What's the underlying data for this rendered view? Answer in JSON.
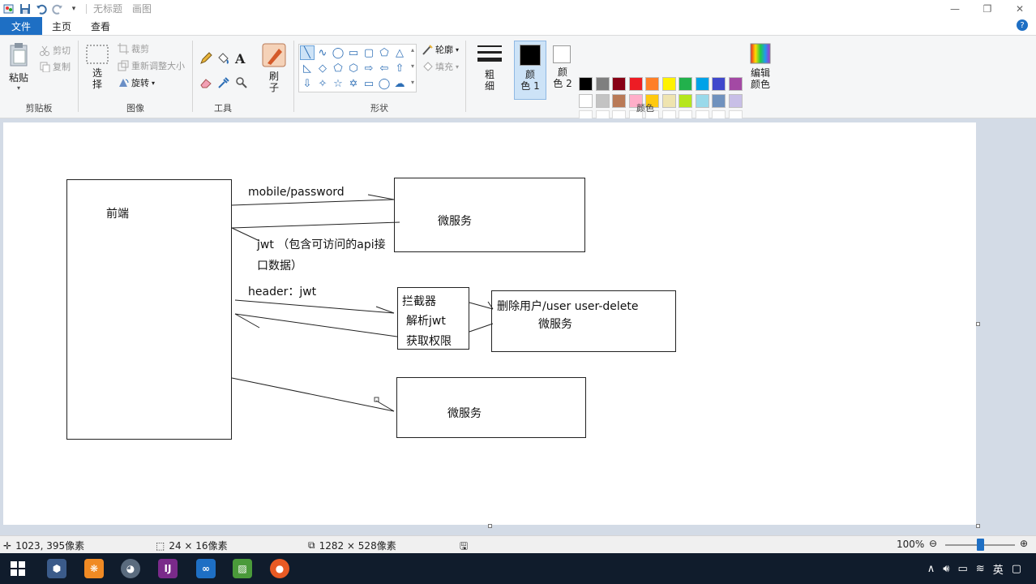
{
  "window": {
    "title": "无标题",
    "app_name": "画图",
    "controls": [
      "minimize-icon",
      "restore-icon",
      "close-icon"
    ]
  },
  "menu": {
    "file": "文件",
    "tabs": [
      "主页",
      "查看"
    ]
  },
  "ribbon": {
    "clipboard": {
      "label": "剪贴板",
      "paste": "粘贴",
      "cut": "剪切",
      "copy": "复制"
    },
    "image": {
      "label": "图像",
      "select": "选\n择",
      "crop": "裁剪",
      "resize": "重新调整大小",
      "rotate": "旋转"
    },
    "tools": {
      "label": "工具"
    },
    "brush": {
      "label": "刷\n子"
    },
    "shapes": {
      "label": "形状",
      "outline": "轮廓",
      "fill": "填充"
    },
    "size": {
      "label": "粗\n细"
    },
    "colors": {
      "label": "颜色",
      "color1": "颜\n色 1",
      "color2": "颜\n色 2",
      "edit": "编辑\n颜色",
      "color1_value": "#000000",
      "color2_value": "#ffffff",
      "palette_row1": [
        "#000000",
        "#7f7f7f",
        "#880015",
        "#ed1c24",
        "#ff7f27",
        "#fff200",
        "#22b14c",
        "#00a2e8",
        "#3f48cc",
        "#a349a4"
      ],
      "palette_row2": [
        "#ffffff",
        "#c3c3c3",
        "#b97a57",
        "#ffaec9",
        "#ffc90e",
        "#efe4b0",
        "#b5e61d",
        "#99d9ea",
        "#7092be",
        "#c8bfe7"
      ]
    }
  },
  "drawing": {
    "frontend": "前端",
    "arrow1": "mobile/password",
    "microservice1": "微服务",
    "jwt_line1": "jwt （包含可访问的api接",
    "jwt_line2": "口数据）",
    "header": "header：jwt",
    "interceptor1": "拦截器",
    "interceptor2": "解析jwt",
    "interceptor3": "获取权限",
    "delete_service1": "删除用户/user   user-delete",
    "delete_service2": "微服务",
    "microservice3": "微服务"
  },
  "status": {
    "cursor": "1023, 395像素",
    "selection": "24 × 16像素",
    "canvas_size": "1282 × 528像素",
    "zoom": "100%",
    "zoom_level": 100
  },
  "taskbar": {
    "input_method": "英",
    "apps": [
      "windows-start-icon",
      "app-icon",
      "app-icon",
      "app-icon",
      "app-icon",
      "app-icon",
      "app-icon",
      "app-icon"
    ]
  }
}
